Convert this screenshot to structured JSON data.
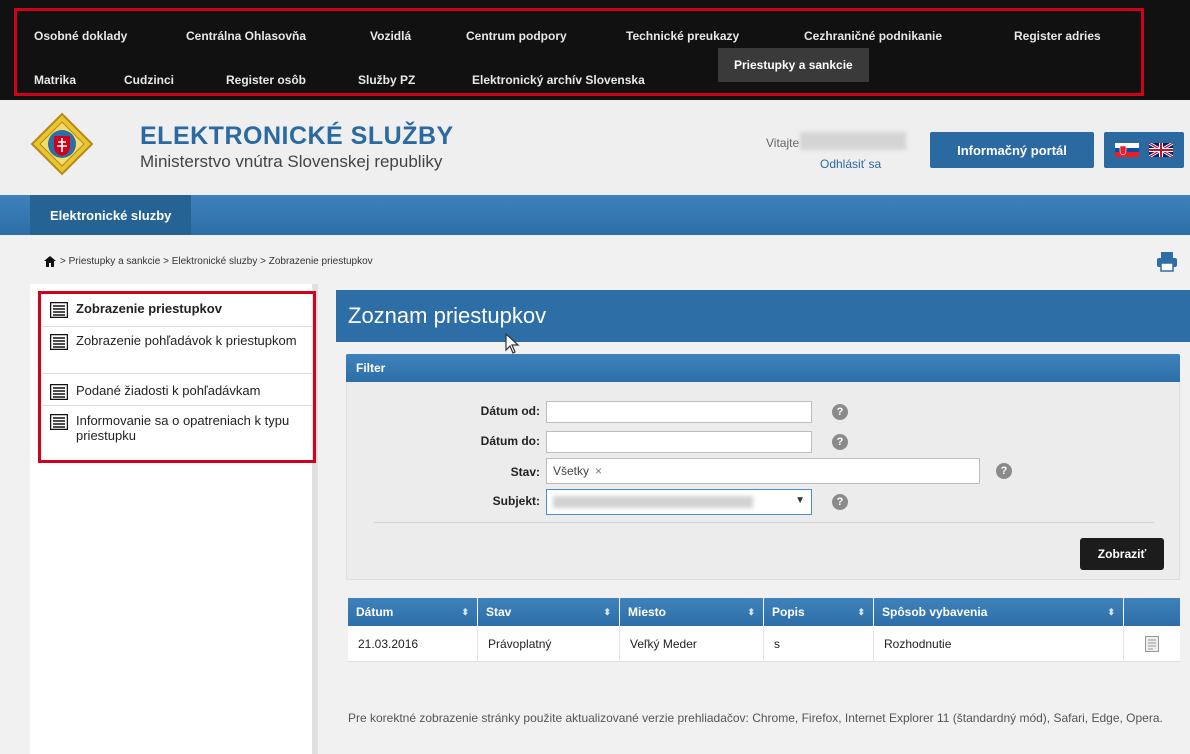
{
  "top_nav": {
    "row1": [
      "Osobné doklady",
      "Centrálna Ohlasovňa",
      "Vozidlá",
      "Centrum podpory",
      "Technické preukazy",
      "Cezhraničné podnikanie",
      "Register adries"
    ],
    "row2": [
      "Matrika",
      "Cudzinci",
      "Register osôb",
      "Služby PZ",
      "Elektronický archív Slovenska"
    ],
    "active": "Priestupky a sankcie"
  },
  "header": {
    "title": "ELEKTRONICKÉ SLUŽBY",
    "subtitle": "Ministerstvo vnútra Slovenskej republiky",
    "welcome": "Vitajte",
    "logout": "Odhlásiť sa",
    "portal_button": "Informačný portál"
  },
  "band": {
    "tab": "Elektronické sluzby"
  },
  "breadcrumb": "> Priestupky a sankcie > Elektronické sluzby > Zobrazenie priestupkov",
  "sidebar": {
    "items": [
      {
        "label": "Zobrazenie priestupkov"
      },
      {
        "label": "Zobrazenie pohľadávok k priestupkom"
      },
      {
        "label": "Podané žiadosti k pohľadávkam"
      },
      {
        "label": "Informovanie sa o opatreniach k typu priestupku"
      }
    ]
  },
  "main": {
    "title": "Zoznam priestupkov",
    "filter": {
      "heading": "Filter",
      "date_from_label": "Dátum od:",
      "date_to_label": "Dátum do:",
      "state_label": "Stav:",
      "state_value": "Všetky",
      "state_remove": "×",
      "subject_label": "Subjekt:",
      "help": "?",
      "submit": "Zobraziť"
    },
    "table": {
      "columns": [
        "Dátum",
        "Stav",
        "Miesto",
        "Popis",
        "Spôsob vybavenia"
      ],
      "rows": [
        {
          "datum": "21.03.2016",
          "stav": "Právoplatný",
          "miesto": "Veľký Meder",
          "popis": "s",
          "sposob": "Rozhodnutie"
        }
      ]
    },
    "footer_note": "Pre korektné zobrazenie stránky použite aktualizované verzie prehliadačov: Chrome, Firefox, Internet Explorer 11 (štandardný mód), Safari, Edge, Opera."
  },
  "colors": {
    "brand_blue": "#2d6ea7",
    "highlight_red": "#d0021b",
    "nav_bg": "#111111"
  }
}
